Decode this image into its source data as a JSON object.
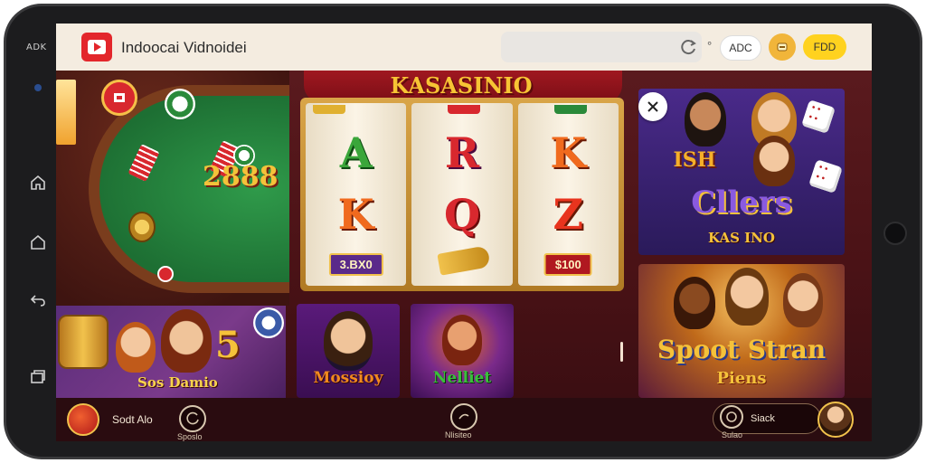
{
  "device": {
    "side_label": "ADK",
    "nav": [
      "home-outline",
      "home",
      "back",
      "recents"
    ]
  },
  "browser": {
    "title": "Indoocai Vidnoidei",
    "url": "",
    "add_label": "ADC",
    "feed_label": "FDD",
    "small_glyph": "°"
  },
  "slot": {
    "title": "KASASINIO",
    "reels": [
      {
        "top": "A",
        "mid": "K",
        "tag": "3.BX0"
      },
      {
        "top": "R",
        "mid": "Q",
        "tag": ""
      },
      {
        "top": "K",
        "mid": "Z",
        "tag": "$100"
      }
    ]
  },
  "table": {
    "digits": "2888"
  },
  "promos": {
    "left_big": "5",
    "left_title": "Sos Damio",
    "tile1_title": "Mossioy",
    "tile2_title": "Nelliet",
    "right_top_title": "Cllers",
    "right_top_sub": "KAS INO",
    "right_top_ish": "ISH",
    "right_bottom_title": "Spoot Stran",
    "right_bottom_sub": "Piens"
  },
  "bottom_bar": {
    "left_label": "Sodt Alo",
    "center_left_sub": "Sposlo",
    "center_sub": "Nlisiteo",
    "right_label": "Siack",
    "right_sub": "Sulao"
  },
  "colors": {
    "header_bg": "#f4ece0",
    "game_bg": "#4a1216",
    "accent_gold": "#f7c434",
    "brand_red": "#e3262b"
  }
}
